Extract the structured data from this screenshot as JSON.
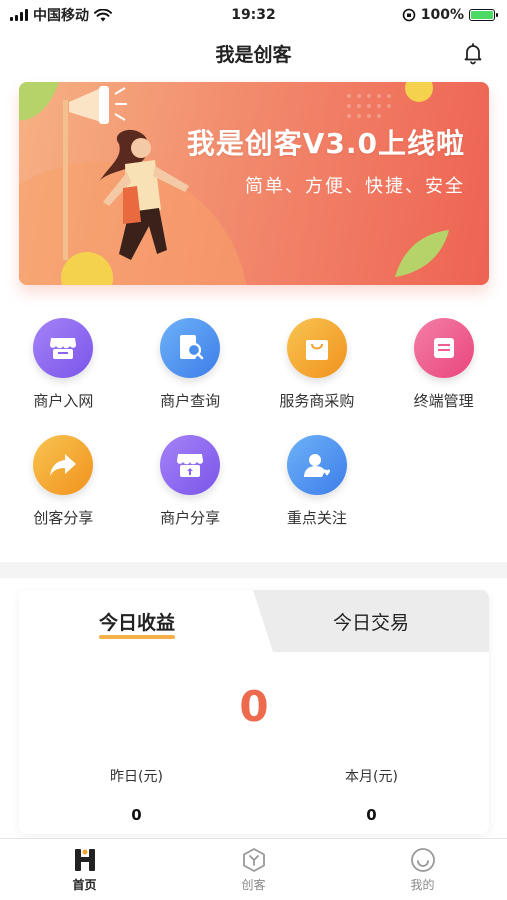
{
  "status_bar": {
    "carrier": "中国移动",
    "time": "19:32",
    "battery": "100%"
  },
  "nav": {
    "title": "我是创客"
  },
  "banner": {
    "title": "我是创客V3.0上线啦",
    "subtitle": "简单、方便、快捷、安全"
  },
  "grid": [
    {
      "label": "商户入网",
      "icon": "store-icon",
      "color": "#8a64f0"
    },
    {
      "label": "商户查询",
      "icon": "search-doc-icon",
      "color": "#4a8ff0"
    },
    {
      "label": "服务商采购",
      "icon": "shopping-bag-icon",
      "color": "#f2a22e"
    },
    {
      "label": "终端管理",
      "icon": "terminal-icon",
      "color": "#ef5d8e"
    },
    {
      "label": "创客分享",
      "icon": "share-arrow-icon",
      "color": "#f2a22e"
    },
    {
      "label": "商户分享",
      "icon": "store-share-icon",
      "color": "#8a64f0"
    },
    {
      "label": "重点关注",
      "icon": "user-heart-icon",
      "color": "#4a8ff0"
    }
  ],
  "card": {
    "tabs": [
      "今日收益",
      "今日交易"
    ],
    "value": "0",
    "stats": [
      {
        "label": "昨日(元)",
        "value": "0"
      },
      {
        "label": "本月(元)",
        "value": "0"
      }
    ]
  },
  "tabbar": [
    {
      "label": "首页",
      "icon": "home-icon"
    },
    {
      "label": "创客",
      "icon": "maker-icon"
    },
    {
      "label": "我的",
      "icon": "profile-icon"
    }
  ],
  "colors": {
    "accent": "#ee6a4f",
    "underline": "#f6b04a"
  }
}
